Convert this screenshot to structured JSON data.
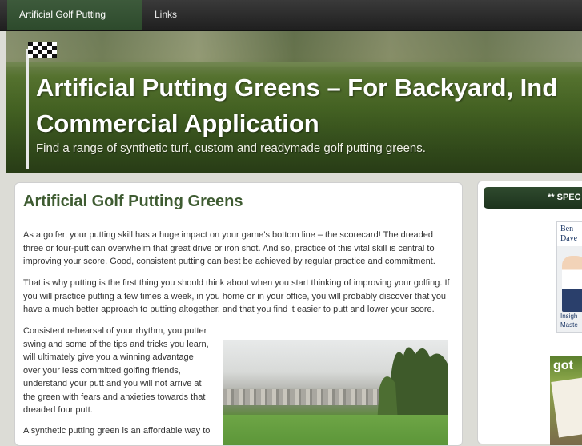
{
  "nav": {
    "items": [
      {
        "label": "Artificial Golf Putting Greens",
        "active": true
      },
      {
        "label": "Links",
        "active": false
      }
    ],
    "active_color": "#3d5a3b"
  },
  "header": {
    "title_line1": "Artificial Putting Greens – For Backyard, Ind",
    "title_line2": "Commercial Application",
    "tagline": "Find a range of synthetic turf, custom and readymade golf putting greens."
  },
  "article": {
    "heading": "Artificial Golf Putting Greens",
    "paragraphs": [
      [
        "As a golfer, your putting skill has a huge impact on your game’s bottom line – the scorecard! The dreaded",
        "three or four-putt can overwhelm that great drive or iron shot. And so, practice of this vital skill is central to",
        "improving your score. Good, consistent putting can best be achieved by regular practice and commitment."
      ],
      [
        "That is why putting is the first thing you should think about when you start thinking of improving your golfing. If",
        "you will practice putting a few times a week, in you home or in your office, you will probably discover that you",
        "have a much better approach to putting altogether, and that you find it easier to putt and lower your score."
      ],
      [
        "Consistent rehearsal of your rhythm, you putter",
        "swing and some of the tips and tricks you learn,",
        "will ultimately give you a winning advantage",
        "over your less committed golfing friends,",
        "understand your putt and you will not arrive at",
        "the green with fears and anxieties towards that",
        "dreaded four putt."
      ],
      [
        "A synthetic putting green is an affordable way to"
      ]
    ],
    "heading_color": "#3f5c32"
  },
  "sidebar": {
    "special_label": "** SPEC",
    "book1": {
      "line1": "Ben",
      "line2": "Dave",
      "line3": "Insigh",
      "line4": "Maste"
    },
    "book2": {
      "logo": "got"
    }
  }
}
